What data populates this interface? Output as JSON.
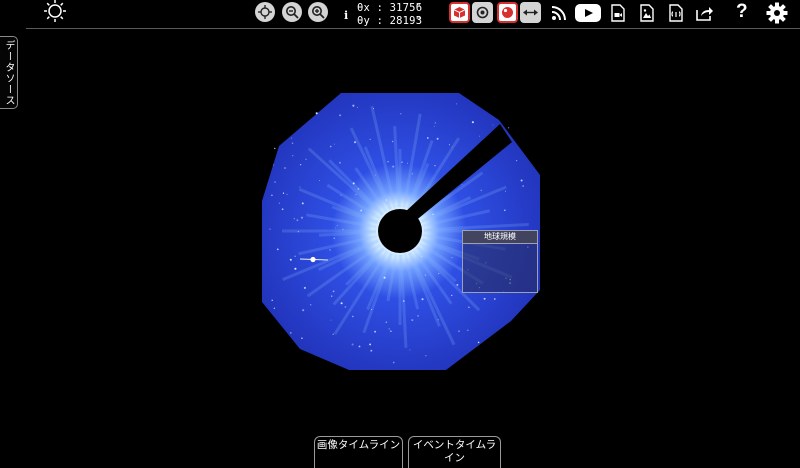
{
  "toolbar": {
    "coord_x_label": "θx",
    "coord_x_value": ": 31756",
    "coord_y_label": "θy",
    "coord_y_value": ": 28193",
    "coord_unit": "\"",
    "info": "i",
    "help": "?"
  },
  "sidebar": {
    "data_source_tab": "データソース"
  },
  "viewer": {
    "earth_scale_label": "地球規模"
  },
  "bottom": {
    "image_timeline": "画像タイムライン",
    "event_timeline": "イベントタイムライン"
  },
  "colors": {
    "coronagraph_blue": "#2a3fd8",
    "background": "#000000",
    "accent_red": "#d63030"
  },
  "icons": [
    "sun-icon",
    "move-icon",
    "zoom-out-icon",
    "zoom-in-icon",
    "info-icon",
    "layer-cube-icon",
    "layer-disc-icon",
    "layer-sphere-icon",
    "arrows-horizontal-icon",
    "rss-icon",
    "youtube-icon",
    "movie-icon",
    "image-icon",
    "data-file-icon",
    "share-icon",
    "help-icon",
    "gear-icon"
  ]
}
